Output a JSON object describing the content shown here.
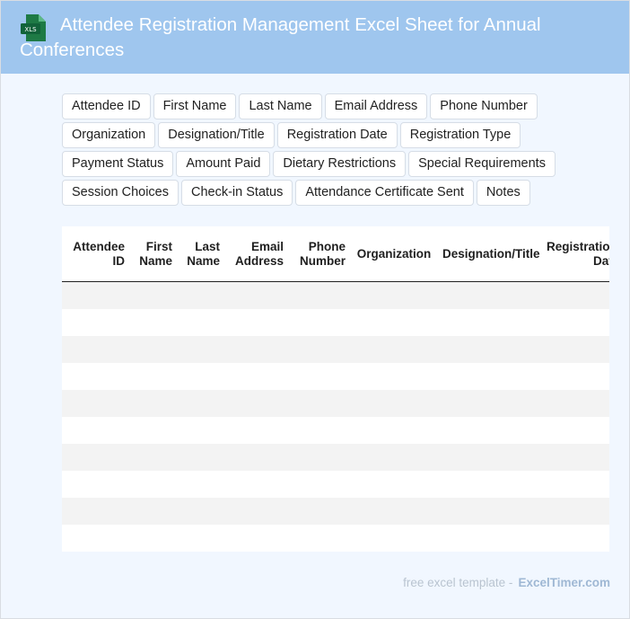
{
  "header": {
    "title": "Attendee Registration Management Excel Sheet for Annual Conferences",
    "icon": "excel-file-icon",
    "icon_text": "XLS",
    "background_color": "#9fc6ee"
  },
  "fields": [
    "Attendee ID",
    "First Name",
    "Last Name",
    "Email Address",
    "Phone Number",
    "Organization",
    "Designation/Title",
    "Registration Date",
    "Registration Type",
    "Payment Status",
    "Amount Paid",
    "Dietary Restrictions",
    "Special Requirements",
    "Session Choices",
    "Check-in Status",
    "Attendance Certificate Sent",
    "Notes"
  ],
  "table": {
    "columns": [
      [
        "Attendee",
        "ID"
      ],
      [
        "First",
        "Name"
      ],
      [
        "Last",
        "Name"
      ],
      [
        "Email",
        "Address"
      ],
      [
        "Phone",
        "Number"
      ],
      [
        "Organization"
      ],
      [
        "Designation/Title"
      ],
      [
        "Registration",
        "Date"
      ]
    ],
    "empty_rows": 10
  },
  "footer": {
    "prefix": "free excel template -",
    "brand": "ExcelTimer.com"
  }
}
